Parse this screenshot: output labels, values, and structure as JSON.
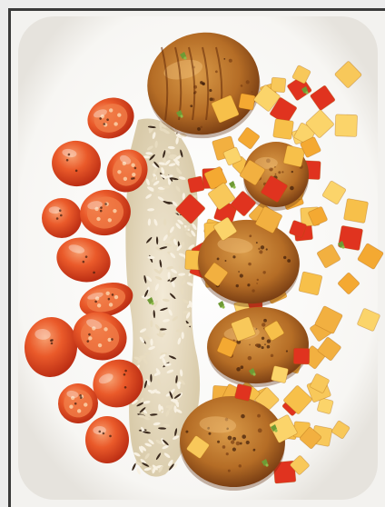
{
  "image": {
    "subject": "plated-dish",
    "colors": {
      "background": "#f7f6f3",
      "frame": "#3a3a3a",
      "page": "#ececec",
      "plate": "#fbfbfa",
      "scallop": "#c07a2c",
      "scallop_crust": "#7a3e12",
      "tomato": "#e24a22",
      "tomato_highlight": "#f58a55",
      "rice": "#efe6d2",
      "wild_rice": "#3b2a1e",
      "mango": "#f6b43c",
      "pepper": "#e0331f",
      "herb": "#6f9a35"
    },
    "elements": [
      "plate",
      "seared-scallops",
      "roasted-cherry-tomatoes",
      "wild-rice-pilaf",
      "mango-pepper-salsa",
      "herb-garnish"
    ]
  }
}
